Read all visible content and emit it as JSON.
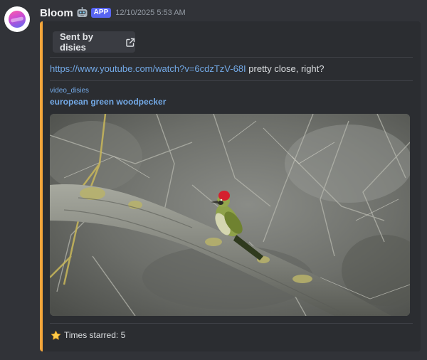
{
  "message": {
    "author": "Bloom",
    "app_badge": "APP",
    "timestamp": "12/10/2025 5:53 AM"
  },
  "embed": {
    "accent_color": "#f4a63b",
    "sent_button_label": "Sent by disies",
    "content_link": "https://www.youtube.com/watch?v=6cdzTzV-68I",
    "content_text": " pretty close, right?",
    "provider": "video_disies",
    "video_title": "european green woodpecker",
    "footer_text": "Times starred: 5"
  },
  "icons": {
    "avatar": "bloom-avatar",
    "bot": "robot-face-icon",
    "external": "external-link-icon",
    "star": "star-icon"
  },
  "colors": {
    "background": "#313338",
    "embed_background": "#2b2d31",
    "link": "#73a9e6",
    "badge": "#5865f2"
  }
}
